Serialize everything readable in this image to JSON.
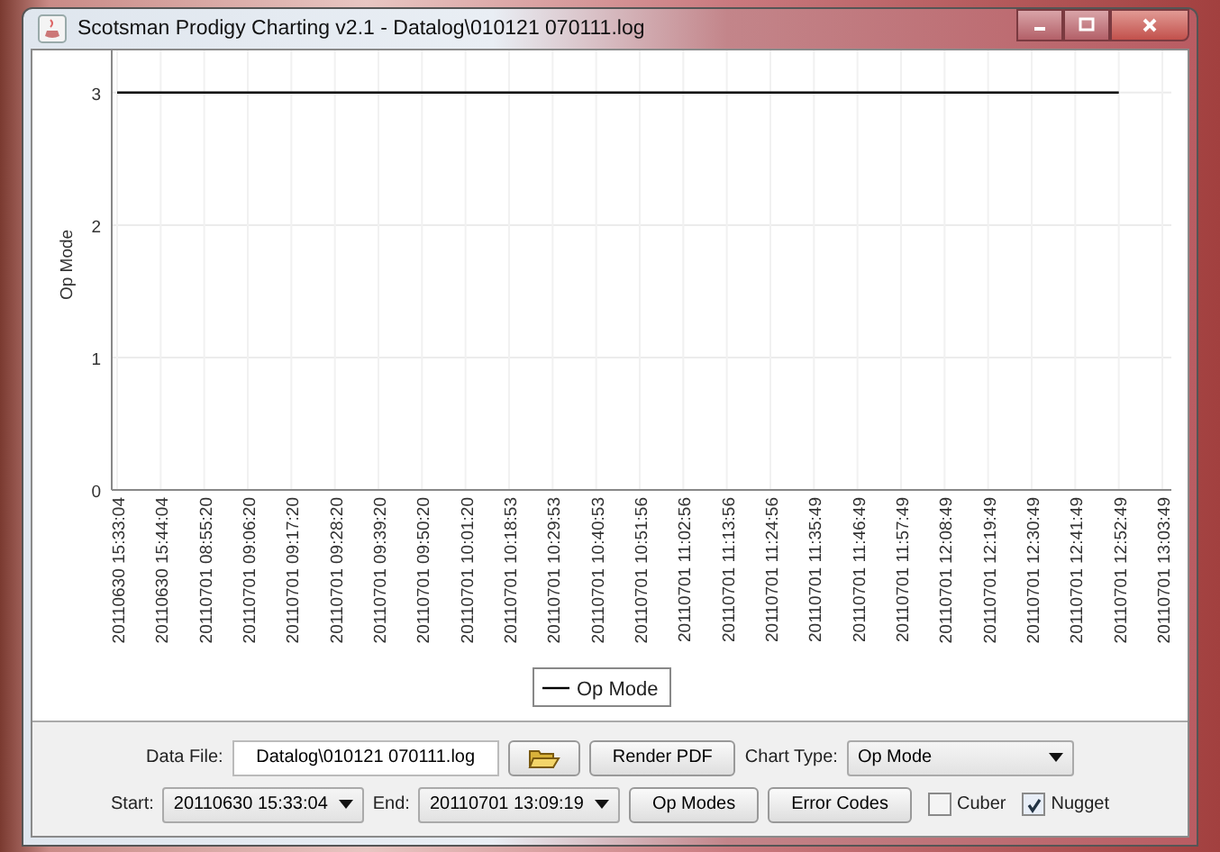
{
  "window": {
    "title": "Scotsman Prodigy Charting v2.1 - Datalog\\010121 070111.log"
  },
  "chart": {
    "chart_data": {
      "type": "line",
      "ylabel": "Op Mode",
      "categories": [
        "20110630 15:33:04",
        "20110630 15:44:04",
        "20110701 08:55:20",
        "20110701 09:06:20",
        "20110701 09:17:20",
        "20110701 09:28:20",
        "20110701 09:39:20",
        "20110701 09:50:20",
        "20110701 10:01:20",
        "20110701 10:18:53",
        "20110701 10:29:53",
        "20110701 10:40:53",
        "20110701 10:51:56",
        "20110701 11:02:56",
        "20110701 11:13:56",
        "20110701 11:24:56",
        "20110701 11:35:49",
        "20110701 11:46:49",
        "20110701 11:57:49",
        "20110701 12:08:49",
        "20110701 12:19:49",
        "20110701 12:30:49",
        "20110701 12:41:49",
        "20110701 12:52:49",
        "20110701 13:03:49"
      ],
      "series": [
        {
          "name": "Op Mode",
          "color": "#000000",
          "values": [
            3,
            3,
            3,
            3,
            3,
            3,
            3,
            3,
            3,
            3,
            3,
            3,
            3,
            3,
            3,
            3,
            3,
            3,
            3,
            3,
            3,
            3,
            3,
            3,
            null
          ]
        }
      ],
      "ylim": [
        0,
        3.4
      ],
      "yticks": [
        0,
        1,
        2,
        3
      ],
      "grid": true
    }
  },
  "controls": {
    "data_file_label": "Data File:",
    "data_file": "Datalog\\010121 070111.log",
    "render_button": "Render PDF",
    "chart_type_label": "Chart Type:",
    "chart_type": "Op Mode",
    "start_label": "Start:",
    "start": "20110630 15:33:04",
    "end_label": "End:",
    "end": "20110701 13:09:19",
    "op_modes_button": "Op Modes",
    "error_codes_button": "Error Codes",
    "checkboxes": [
      {
        "label": "Cuber",
        "checked": false
      },
      {
        "label": "Nugget",
        "checked": true
      }
    ]
  }
}
